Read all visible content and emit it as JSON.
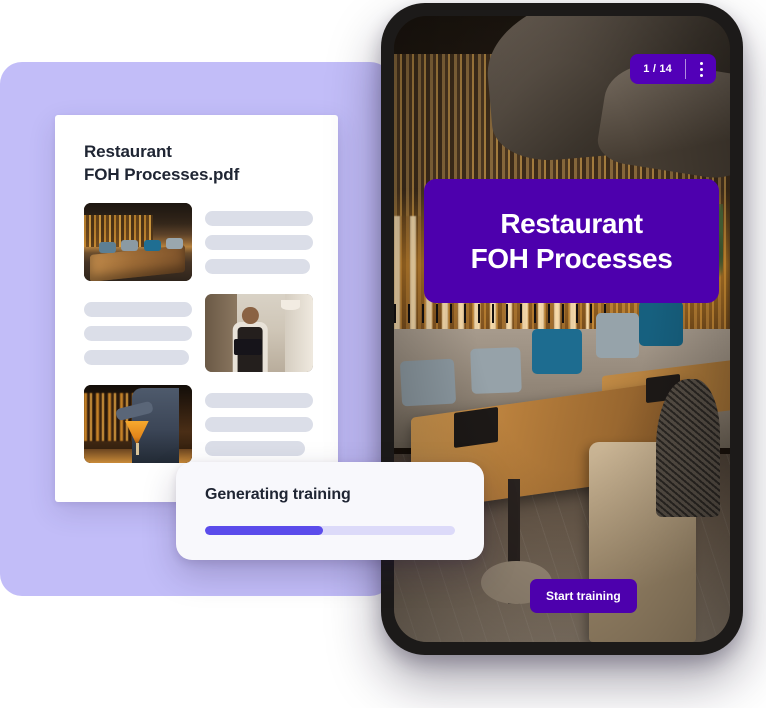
{
  "document_card": {
    "title": "Restaurant\nFOH Processes.pdf",
    "rows": [
      {
        "thumbnail": "restaurant-dining-room-photo",
        "side": "left",
        "lines": 3
      },
      {
        "thumbnail": "server-with-tablet-photo",
        "side": "right",
        "lines": 3
      },
      {
        "thumbnail": "bartender-pouring-cocktail-photo",
        "side": "left",
        "lines": 3
      }
    ]
  },
  "progress_popup": {
    "title": "Generating training",
    "percent": 47,
    "fill_color": "#5b4ceb",
    "track_color": "#dcdaf9"
  },
  "phone": {
    "page_indicator": "1 / 14",
    "menu_icon": "more-vertical-icon",
    "slide_title": "Restaurant\nFOH Processes",
    "start_button": "Start training",
    "background_photo": "restaurant-interior-banquette-photo"
  },
  "colors": {
    "lavender": "#c2bdf8",
    "deep_purple": "#4d00ad",
    "badge_purple": "#5200b8",
    "progress_purple": "#5b4ceb",
    "placeholder_grey": "#dbdee8",
    "heading_navy": "#1f2533",
    "phone_frame": "#1c1a19",
    "popup_bg": "#f8f8fc"
  }
}
